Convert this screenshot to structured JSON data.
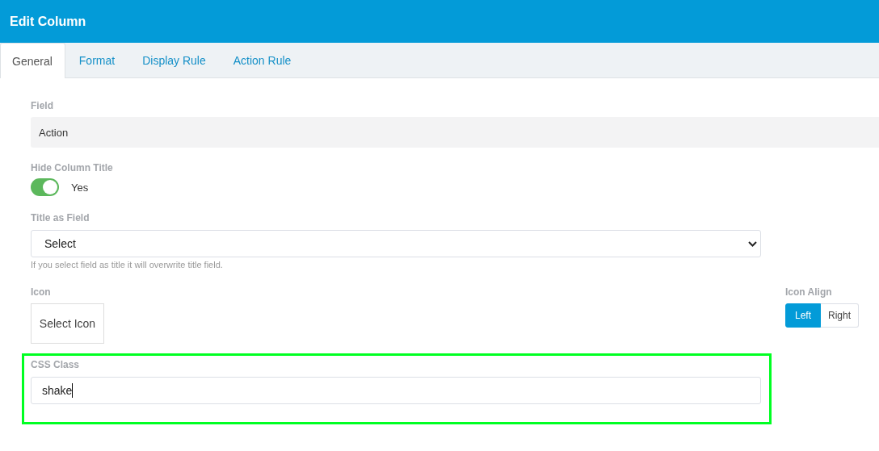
{
  "window": {
    "title": "Edit Column"
  },
  "tabs": [
    {
      "label": "General",
      "selected": true
    },
    {
      "label": "Format",
      "selected": false
    },
    {
      "label": "Display Rule",
      "selected": false
    },
    {
      "label": "Action Rule",
      "selected": false
    }
  ],
  "field": {
    "label": "Field",
    "value": "Action"
  },
  "hide_column_title": {
    "label": "Hide Column Title",
    "on": true,
    "state_label": "Yes"
  },
  "title_as_field": {
    "label": "Title as Field",
    "value": "Select",
    "help": "If you select field as title it will overwrite title field."
  },
  "icon": {
    "label": "Icon",
    "button": "Select Icon"
  },
  "icon_align": {
    "label": "Icon Align",
    "options": [
      {
        "label": "Left",
        "selected": true
      },
      {
        "label": "Right",
        "selected": false
      }
    ]
  },
  "css_class": {
    "label": "CSS Class",
    "value": "shake",
    "highlighted": true
  }
}
